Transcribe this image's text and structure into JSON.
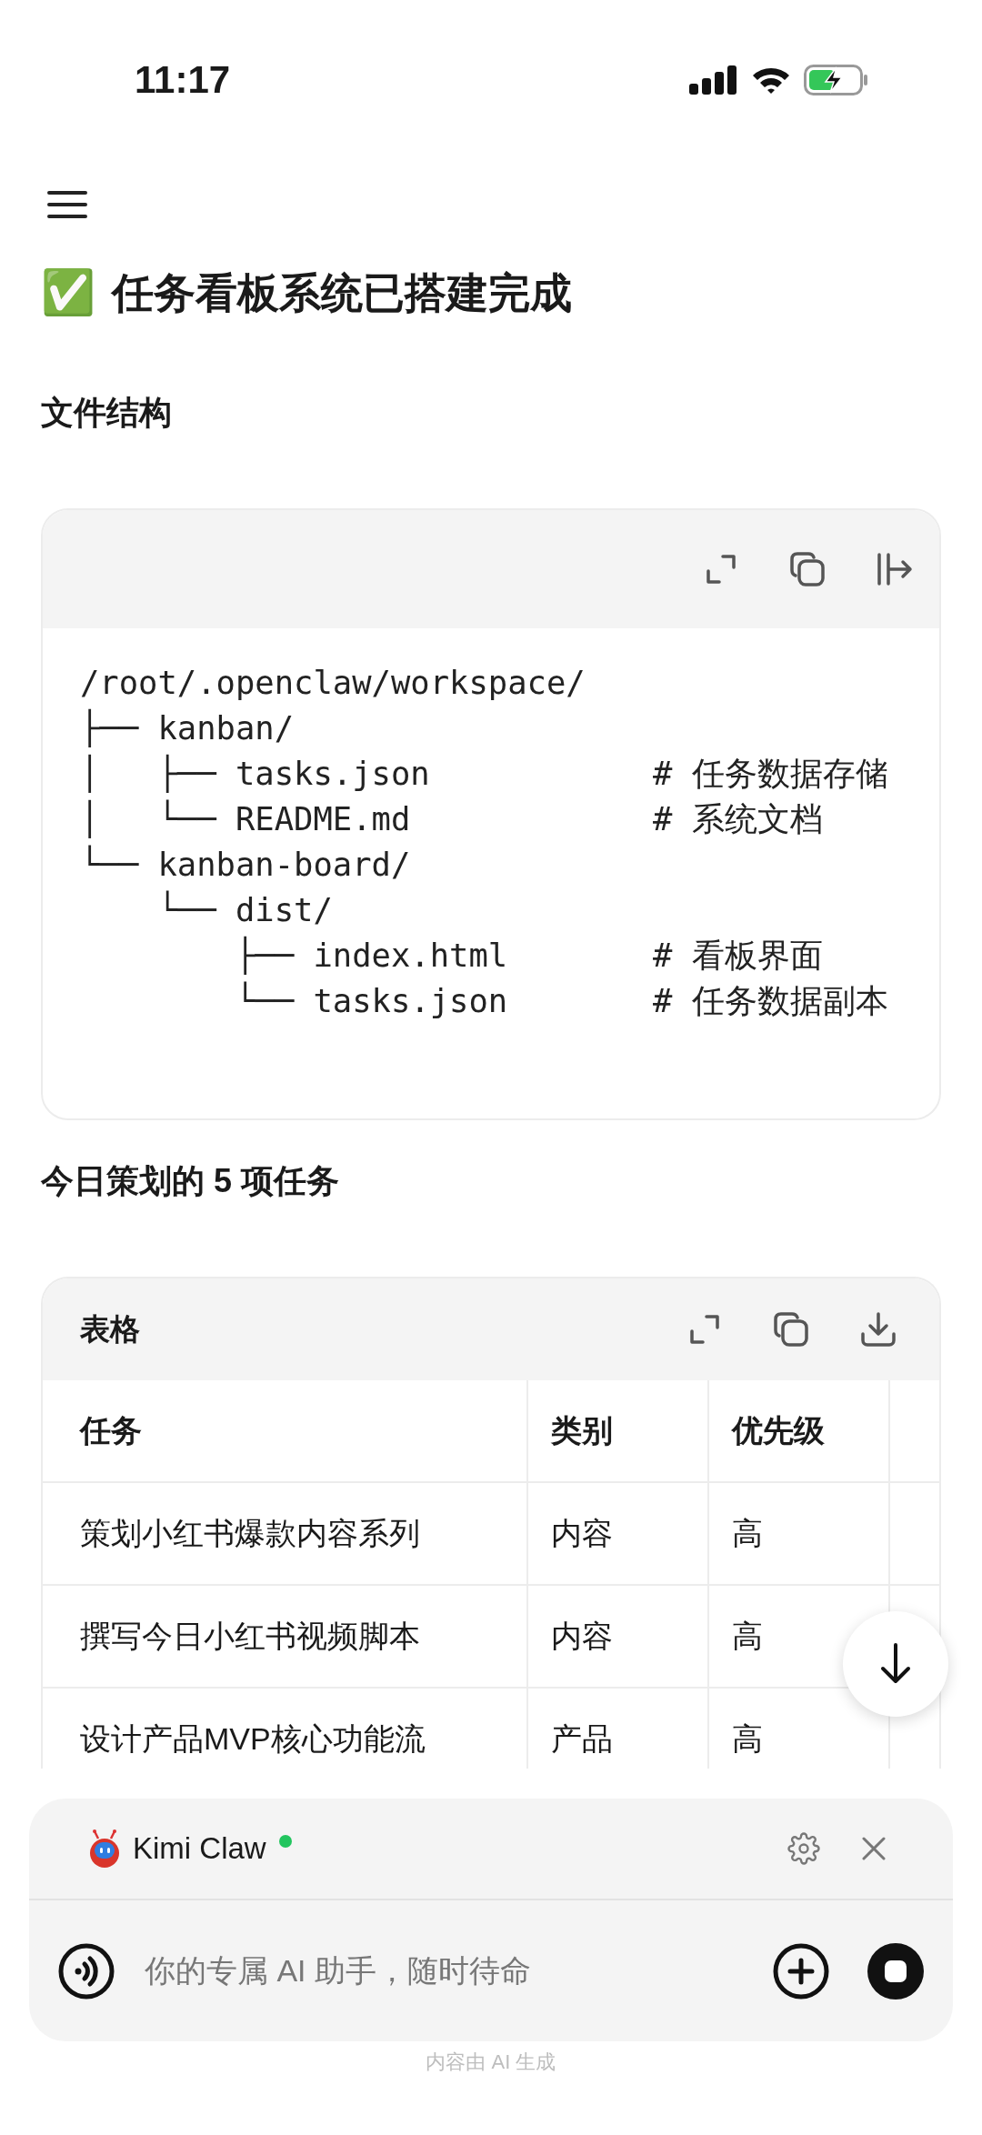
{
  "status_bar": {
    "time": "11:17"
  },
  "title": {
    "emoji": "✅",
    "text": "任务看板系统已搭建完成"
  },
  "sections": [
    {
      "heading": "文件结构"
    },
    {
      "heading": "今日策划的 5 项任务"
    }
  ],
  "code_block": {
    "lines": [
      {
        "text": "/root/.openclaw/workspace/"
      },
      {
        "text": "├── kanban/"
      },
      {
        "text": "│   ├── tasks.json",
        "comment": "# 任务数据存储"
      },
      {
        "text": "│   └── README.md",
        "comment": "# 系统文档"
      },
      {
        "text": "└── kanban-board/"
      },
      {
        "text": "    └── dist/"
      },
      {
        "text": "        ├── index.html",
        "comment": "# 看板界面"
      },
      {
        "text": "        └── tasks.json",
        "comment": "# 任务数据副本"
      }
    ]
  },
  "table": {
    "title": "表格",
    "columns": [
      "任务",
      "类别",
      "优先级"
    ],
    "rows": [
      [
        "策划小红书爆款内容系列",
        "内容",
        "高"
      ],
      [
        "撰写今日小红书视频脚本",
        "内容",
        "高"
      ],
      [
        "设计产品MVP核心功能流",
        "产品",
        "高"
      ]
    ]
  },
  "chat_panel": {
    "assistant_name": "Kimi Claw",
    "online": true,
    "placeholder": "你的专属 AI 助手，随时待命"
  },
  "footer": "内容由 AI 生成"
}
